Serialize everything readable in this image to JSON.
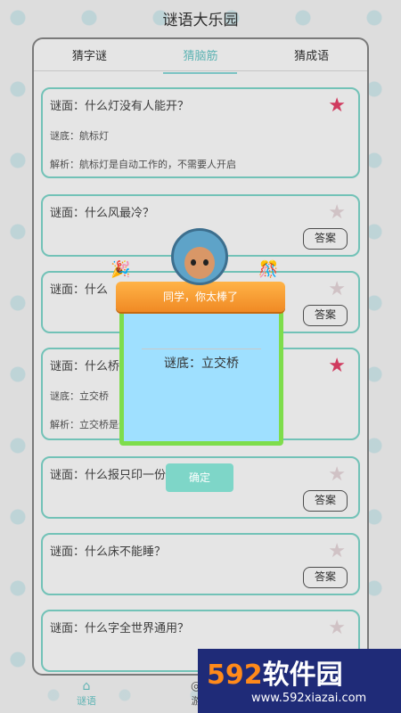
{
  "app": {
    "title": "谜语大乐园"
  },
  "tabs": [
    {
      "label": "猜字谜",
      "active": false
    },
    {
      "label": "猜脑筋",
      "active": true
    },
    {
      "label": "猜成语",
      "active": false
    }
  ],
  "cards": [
    {
      "question": "谜面：什么灯没有人能开？",
      "answer": "谜底：航标灯",
      "explain": "解析：航标灯是自动工作的，不需要人开启",
      "starred": true
    },
    {
      "question": "谜面：什么风最冷？",
      "button": "答案",
      "starred": false
    },
    {
      "question": "谜面：什么",
      "button": "答案",
      "starred": false
    },
    {
      "question": "谜面：什么桥下没水",
      "answer": "谜底：立交桥",
      "explain": "解析：立交桥是道路交叉处的桥梁，下方没有水流",
      "starred": true
    },
    {
      "question": "谜面：什么报只印一份？",
      "button": "答案",
      "starred": false
    },
    {
      "question": "谜面：什么床不能睡？",
      "button": "答案",
      "starred": false
    },
    {
      "question": "谜面：什么字全世界通用？",
      "starred": false
    }
  ],
  "popup": {
    "banner": "同学，你太棒了",
    "answer": "谜底：立交桥",
    "confirm": "确定"
  },
  "nav": [
    {
      "label": "谜语",
      "icon": "home-icon"
    },
    {
      "label": "游",
      "icon": "game-icon"
    }
  ],
  "watermark": {
    "main_num": "592",
    "main_text": "软件园",
    "url": "www.592xiazai.com"
  },
  "colors": {
    "accent": "#7fd8cc",
    "star_on": "#e8426a",
    "popup_bg": "#9fe0ff",
    "popup_border": "#7edd4c"
  }
}
